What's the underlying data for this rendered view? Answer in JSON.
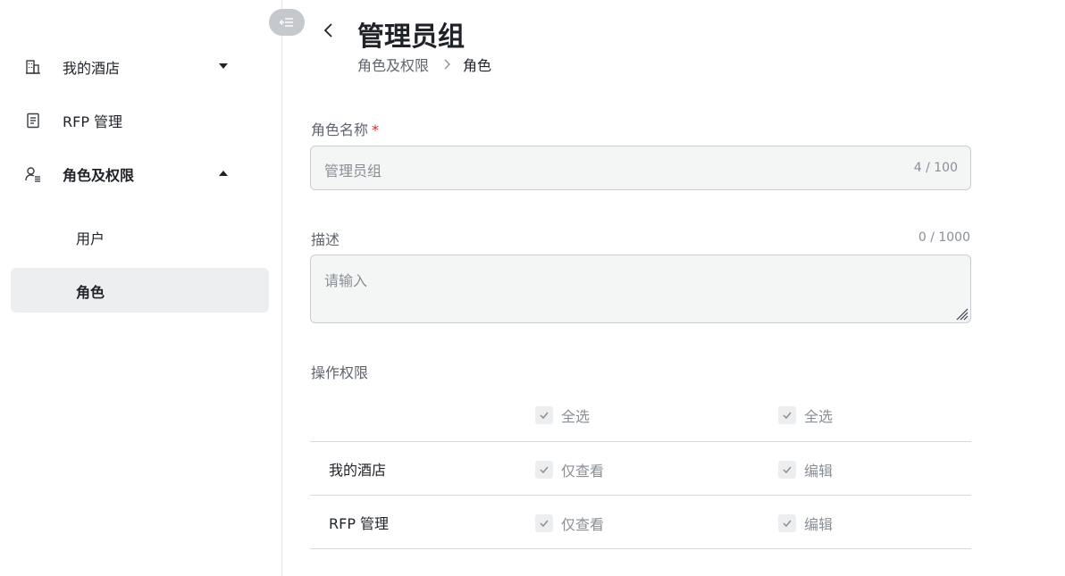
{
  "sidebar": {
    "items": [
      {
        "label": "我的酒店",
        "icon": "building-icon",
        "expanded": false
      },
      {
        "label": "RFP 管理",
        "icon": "document-icon"
      },
      {
        "label": "角色及权限",
        "icon": "user-roles-icon",
        "expanded": true
      }
    ],
    "sub_items": [
      {
        "label": "用户",
        "active": false
      },
      {
        "label": "角色",
        "active": true
      }
    ],
    "collapse_icon": "collapse-sidebar-icon"
  },
  "header": {
    "title": "管理员组",
    "breadcrumb": {
      "parent": "角色及权限",
      "current": "角色"
    }
  },
  "form": {
    "name_label": "角色名称",
    "required_mark": "*",
    "name_value": "管理员组",
    "name_counter": "4 / 100",
    "desc_label": "描述",
    "desc_counter": "0 / 1000",
    "desc_placeholder": "请输入",
    "perm_label": "操作权限"
  },
  "permissions": {
    "select_all": [
      "全选",
      "全选"
    ],
    "rows": [
      {
        "name": "我的酒店",
        "view": "仅查看",
        "edit": "编辑"
      },
      {
        "name": "RFP 管理",
        "view": "仅查看",
        "edit": "编辑"
      }
    ]
  },
  "colors": {
    "required": "#d92d20",
    "active_bg": "#eceef0",
    "border": "#c9cdd2"
  }
}
